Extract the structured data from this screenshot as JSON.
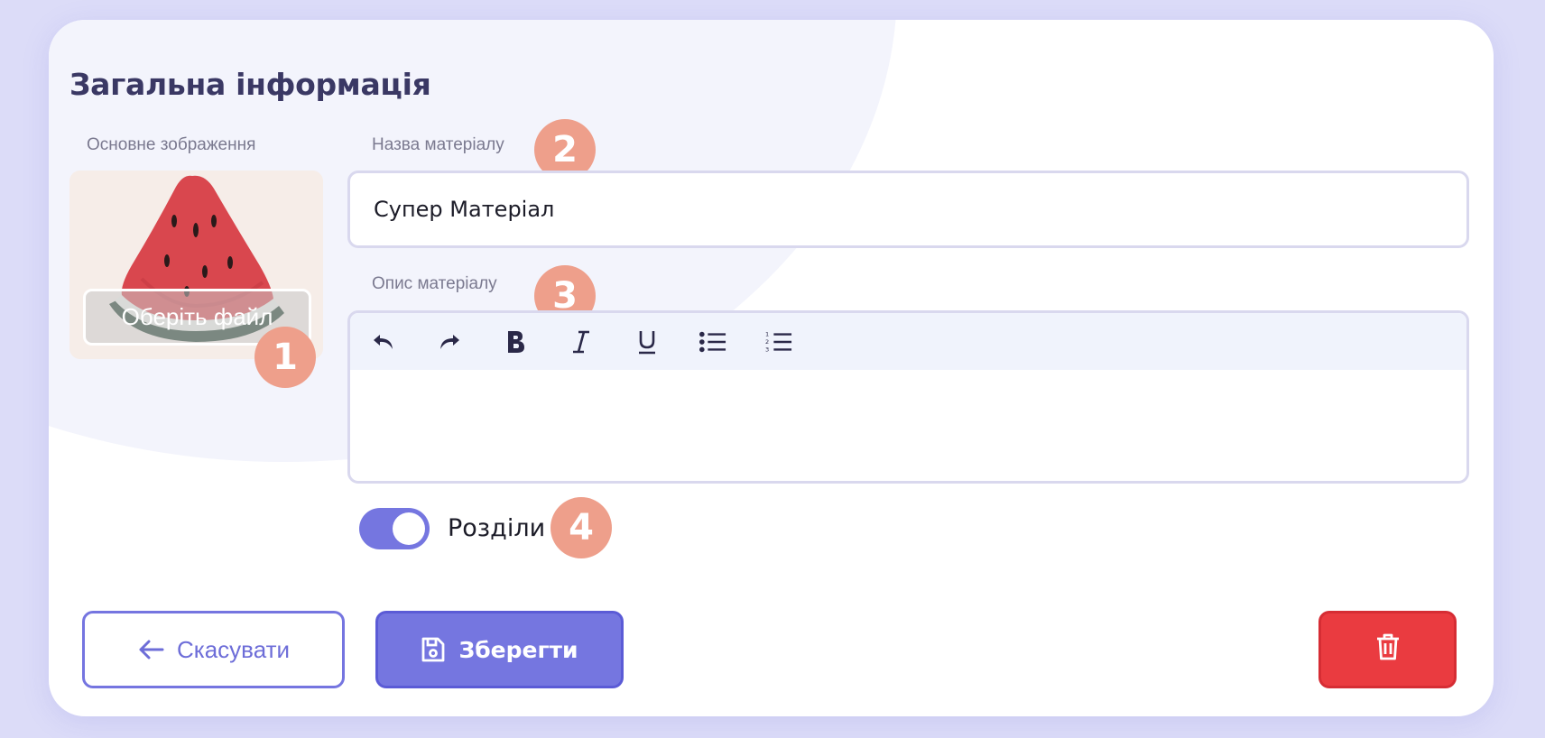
{
  "section": {
    "title": "Загальна інформація"
  },
  "image_field": {
    "label": "Основне зображення",
    "choose_file_label": "Оберіть файл",
    "badge": "1"
  },
  "name_field": {
    "label": "Назва матеріалу",
    "value": "Супер Матеріал",
    "badge": "2"
  },
  "description_field": {
    "label": "Опис матеріалу",
    "badge": "3",
    "toolbar": [
      "undo-icon",
      "redo-icon",
      "bold-icon",
      "italic-icon",
      "underline-icon",
      "bullet-list-icon",
      "numbered-list-icon"
    ]
  },
  "sections_toggle": {
    "label": "Розділи",
    "enabled": true,
    "badge": "4"
  },
  "actions": {
    "cancel_label": "Скасувати",
    "save_label": "Зберегти",
    "delete_icon": "trash-icon"
  },
  "colors": {
    "accent": "#7576e0",
    "heading": "#3a3864",
    "badge": "#ee9f8b",
    "danger": "#ea3b40",
    "background": "#dcdcf8"
  }
}
